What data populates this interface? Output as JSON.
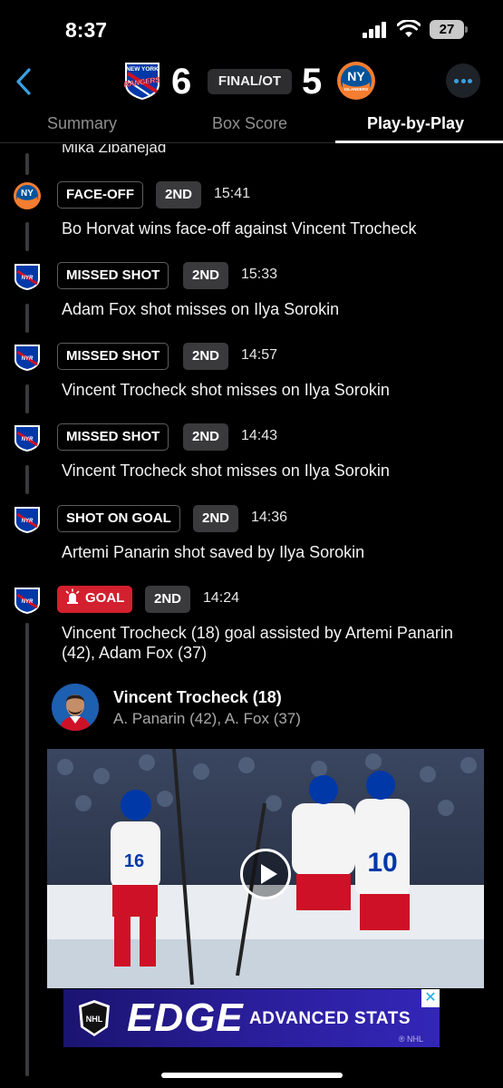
{
  "status_bar": {
    "time": "8:37",
    "battery": "27",
    "icons": [
      "signal-icon",
      "wifi-icon",
      "battery-icon"
    ]
  },
  "header": {
    "home_team": {
      "abbr": "NYR",
      "logo_text": [
        "NEW YORK",
        "RANGERS"
      ],
      "score": "6"
    },
    "away_team": {
      "abbr": "NYI",
      "logo_text": [
        "NY",
        "ISLANDERS"
      ],
      "score": "5"
    },
    "status": "FINAL/OT",
    "colors": {
      "rangers_blue": "#0038a8",
      "rangers_red": "#ce1126",
      "islanders_orange": "#f47d30",
      "islanders_blue": "#00539b",
      "accent": "#3aa0e0",
      "goal_red": "#d2202e"
    }
  },
  "tabs": [
    {
      "label": "Summary",
      "active": false
    },
    {
      "label": "Box Score",
      "active": false
    },
    {
      "label": "Play-by-Play",
      "active": true
    }
  ],
  "feed": {
    "truncated_top": "Mika Zibanejad",
    "plays": [
      {
        "team": "NYI",
        "type": "FACE-OFF",
        "period": "2ND",
        "time": "15:41",
        "description": "Bo Horvat wins face-off against Vincent Trocheck"
      },
      {
        "team": "NYR",
        "type": "MISSED SHOT",
        "period": "2ND",
        "time": "15:33",
        "description": "Adam Fox shot misses on Ilya Sorokin"
      },
      {
        "team": "NYR",
        "type": "MISSED SHOT",
        "period": "2ND",
        "time": "14:57",
        "description": "Vincent Trocheck shot misses on Ilya Sorokin"
      },
      {
        "team": "NYR",
        "type": "MISSED SHOT",
        "period": "2ND",
        "time": "14:43",
        "description": "Vincent Trocheck shot misses on Ilya Sorokin"
      },
      {
        "team": "NYR",
        "type": "SHOT ON GOAL",
        "period": "2ND",
        "time": "14:36",
        "description": "Artemi Panarin shot saved by Ilya Sorokin"
      },
      {
        "team": "NYR",
        "type": "GOAL",
        "period": "2ND",
        "time": "14:24",
        "description": "Vincent Trocheck (18) goal assisted by Artemi Panarin (42), Adam Fox (37)"
      }
    ],
    "goal_detail": {
      "scorer": "Vincent Trocheck (18)",
      "assists": "A. Panarin (42), A. Fox (37)"
    }
  },
  "ad": {
    "brand": "NHL",
    "headline": "EDGE",
    "subline": "ADVANCED STATS",
    "small": "® NHL",
    "close": "✕"
  },
  "video_thumb_jersey_numbers": [
    "16",
    "10"
  ]
}
